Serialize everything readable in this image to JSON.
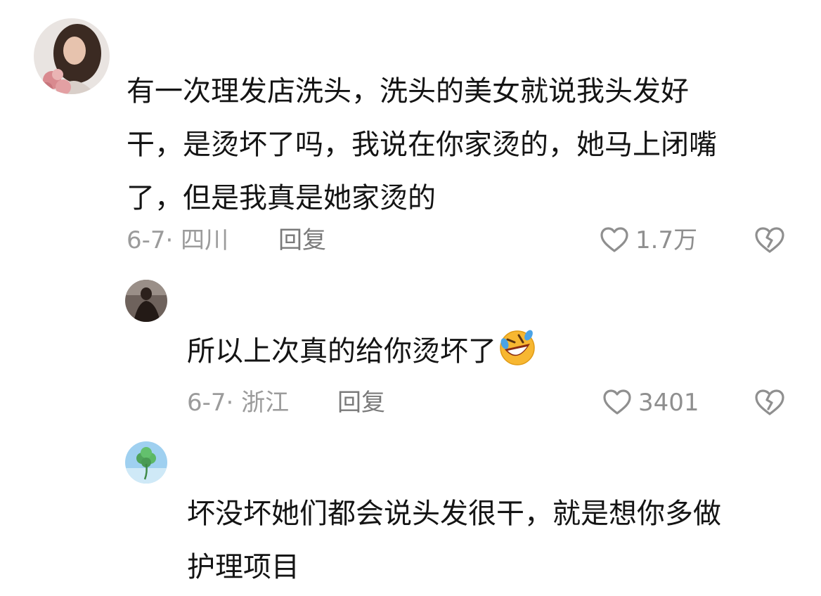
{
  "comments": [
    {
      "avatar": "avatar-woman-with-roses",
      "lines": [
        "有一次理发店洗头，洗头的美女就说我头发好",
        "干，是烫坏了吗，我说在你家烫的，她马上闭嘴",
        "了，但是我真是她家烫的"
      ],
      "meta": "6-7· 四川",
      "reply": "回复",
      "likes": "1.7万"
    },
    {
      "avatar": "avatar-dark-figure",
      "lines": [
        "所以上次真的给你烫坏了"
      ],
      "emoji": "rolling-on-floor-laughing-emoji",
      "meta": "6-7· 浙江",
      "reply": "回复",
      "likes": "3401"
    },
    {
      "avatar": "avatar-clover-sky",
      "lines": [
        "坏没坏她们都会说头发很干，就是想你多做",
        "护理项目"
      ]
    }
  ],
  "colors": {
    "text": "#141414",
    "meta": "#9b9b9b",
    "icon": "#8f8f8f"
  }
}
